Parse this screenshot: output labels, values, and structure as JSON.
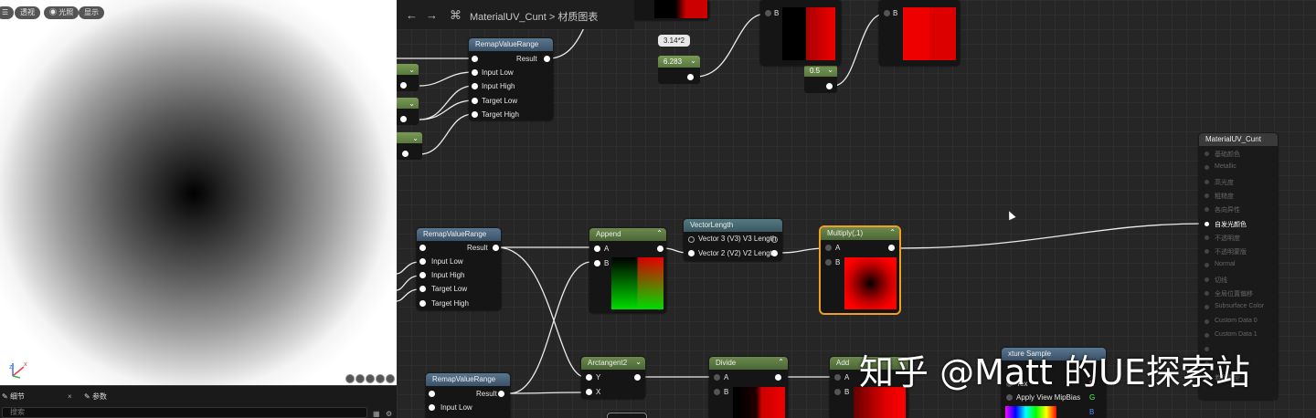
{
  "viewport": {
    "buttons": [
      "",
      "透视",
      "光照",
      "显示"
    ]
  },
  "details": {
    "tab_details": "细节",
    "tab_params": "参数",
    "search_placeholder": "搜索"
  },
  "toolbar": {
    "title": "MaterialUV_Cunt",
    "separator": ">",
    "subtitle": "材质图表"
  },
  "nodes": {
    "remap1": {
      "title": "RemapValueRange",
      "result": "Result",
      "pins": [
        "Input Low",
        "Input High",
        "Target Low",
        "Target High"
      ]
    },
    "remap2": {
      "title": "RemapValueRange",
      "result": "Result",
      "pins": [
        "Input Low",
        "Input High",
        "Target Low",
        "Target High"
      ]
    },
    "remap3": {
      "title": "RemapValueRange",
      "result": "Result",
      "pins": [
        "Input Low"
      ]
    },
    "append": {
      "title": "Append",
      "pin_a": "A",
      "pin_b": "B"
    },
    "vectorlength": {
      "title": "VectorLength",
      "pins": [
        "Vector 3 (V3) V3 Length",
        "Vector 2 (V2) V2 Length"
      ]
    },
    "multiply": {
      "title": "Multiply(,1)",
      "pin_a": "A",
      "pin_b": "B"
    },
    "arctangent": {
      "title": "Arctangent2",
      "pin_y": "Y",
      "pin_x": "X"
    },
    "divide": {
      "title": "Divide",
      "pin_a": "A",
      "pin_b": "B"
    },
    "add": {
      "title": "Add",
      "pin_a": "A",
      "pin_b": "B"
    },
    "texsample": {
      "title": "xture Sample",
      "pin_tex": "Tex",
      "pin_bias": "Apply View MipBias",
      "out_r": "R",
      "out_g": "G",
      "out_b": "B"
    },
    "top1": {
      "pin_b": "B"
    },
    "top2": {
      "pin_b": "B"
    }
  },
  "constants": {
    "c_pi2": "6.283",
    "c_expr": "3.14*2",
    "c_half": "0.5"
  },
  "result": {
    "title": "MaterialUV_Cunt",
    "pins": [
      "基础颜色",
      "Metallic",
      "高光度",
      "粗糙度",
      "各向异性",
      "自发光颜色",
      "不透明度",
      "不透明蒙版",
      "Normal",
      "切线",
      "全局位置偏移",
      "Subsurface Color",
      "Custom Data 0",
      "Custom Data 1",
      "",
      "",
      "着色模型"
    ]
  },
  "watermark": "知乎 @Matt 的UE探索站"
}
